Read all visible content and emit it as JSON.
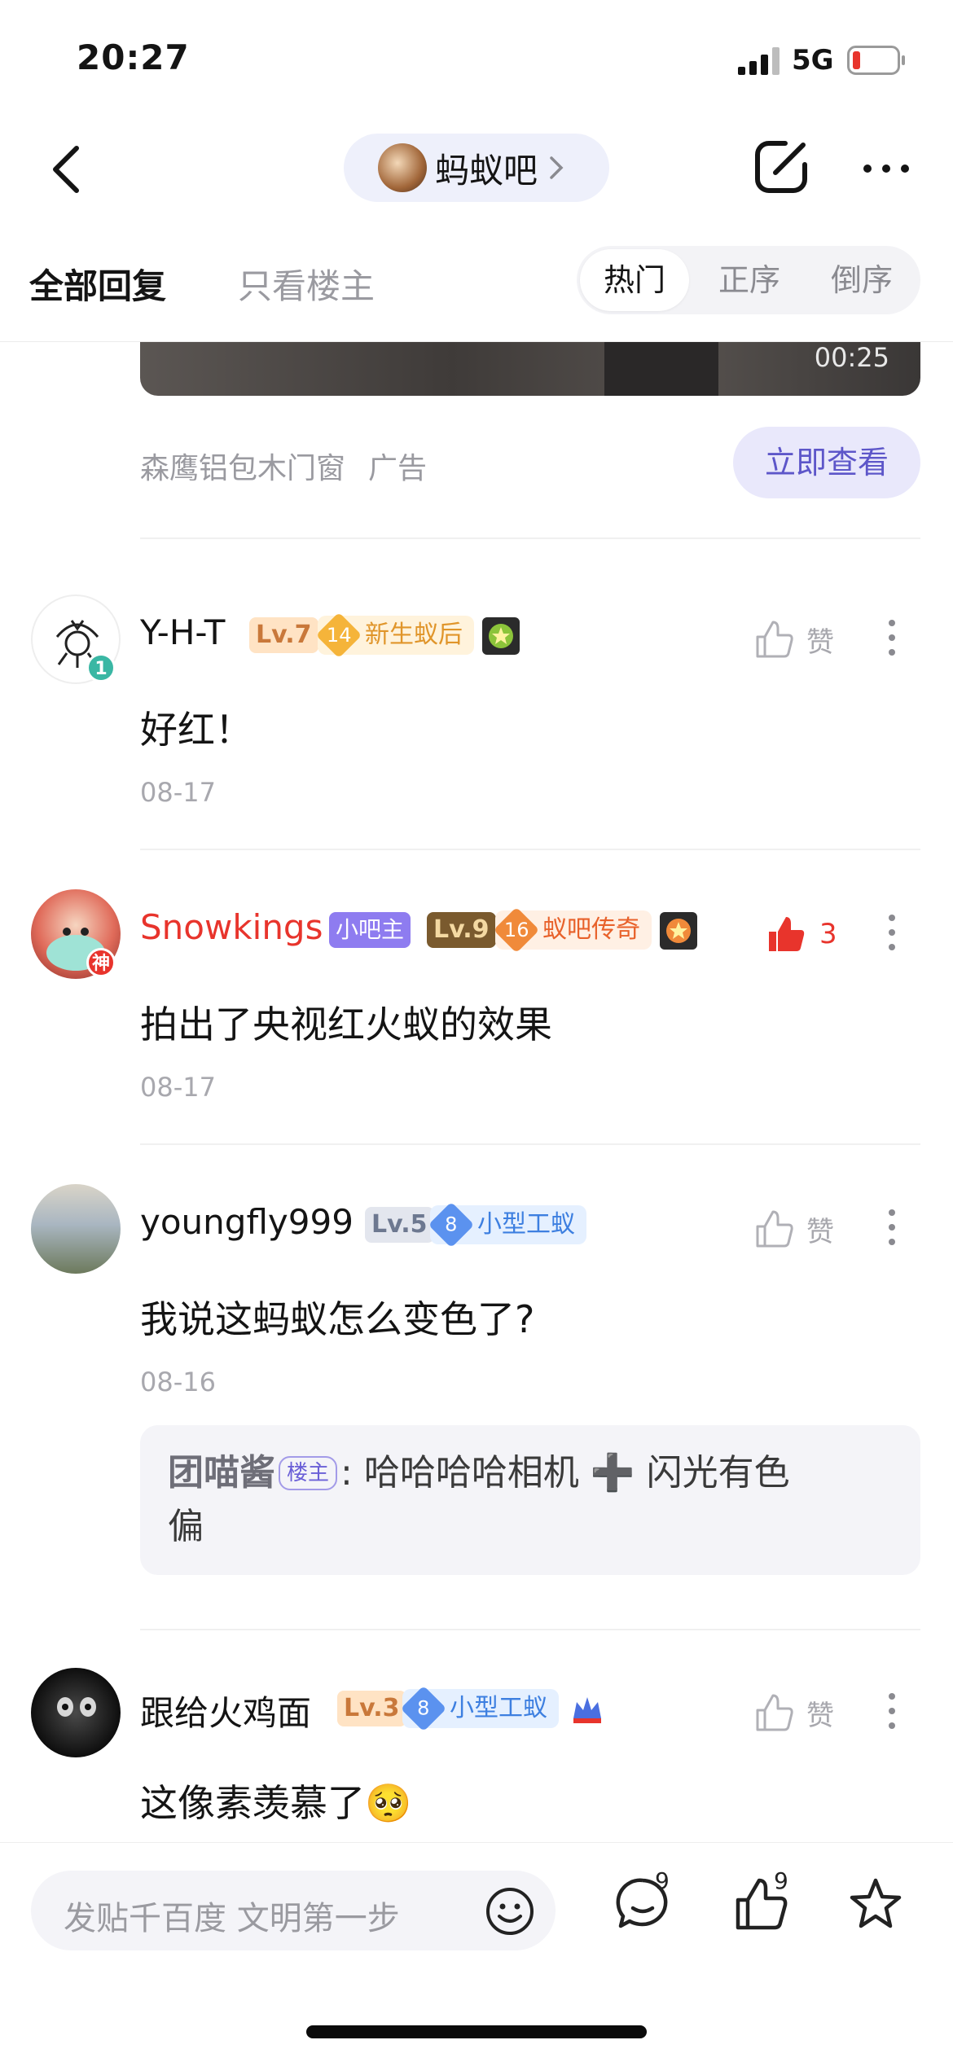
{
  "status_bar": {
    "time": "20:27",
    "network": "5G",
    "battery_level": 0.15
  },
  "nav": {
    "forum_name": "蚂蚁吧"
  },
  "tabs": {
    "all": "全部回复",
    "op_only": "只看楼主",
    "sort": [
      "热门",
      "正序",
      "倒序"
    ],
    "sort_active": "热门"
  },
  "ad": {
    "duration": "00:25",
    "source": "森鹰铝包木门窗",
    "label": "广告",
    "cta": "立即查看"
  },
  "comments": [
    {
      "user": "Y-H-T",
      "level": "Lv.7",
      "badge_num": "14",
      "badge_title": "新生蚁后",
      "avatar_badge": "1",
      "like_label": "赞",
      "text": "好红！",
      "date": "08-17"
    },
    {
      "user": "Snowkings",
      "role": "小吧主",
      "level": "Lv.9",
      "badge_num": "16",
      "badge_title": "蚁吧传奇",
      "avatar_badge": "神",
      "like_count": "3",
      "text": "拍出了央视红火蚁的效果",
      "date": "08-17"
    },
    {
      "user": "youngfly999",
      "level": "Lv.5",
      "badge_num": "8",
      "badge_title": "小型工蚁",
      "like_label": "赞",
      "text": "我说这蚂蚁怎么变色了?",
      "date": "08-16",
      "reply": {
        "user": "团喵酱",
        "tag": "楼主",
        "sep": ":",
        "text_line1": "哈哈哈哈相机",
        "plus": "➕",
        "text_line1b": "闪光有色",
        "text_line2": "偏"
      }
    },
    {
      "user": "跟给火鸡面",
      "level": "Lv.3",
      "badge_num": "8",
      "badge_title": "小型工蚁",
      "like_label": "赞",
      "text": "这像素羡慕了",
      "emoji": "🥺"
    }
  ],
  "bottom_bar": {
    "placeholder": "发贴千百度 文明第一步",
    "comment_count": "9",
    "like_count": "9"
  },
  "colors": {
    "accent_purple": "#5d56c9",
    "like_red": "#e8342c",
    "username_red": "#e8342c"
  }
}
